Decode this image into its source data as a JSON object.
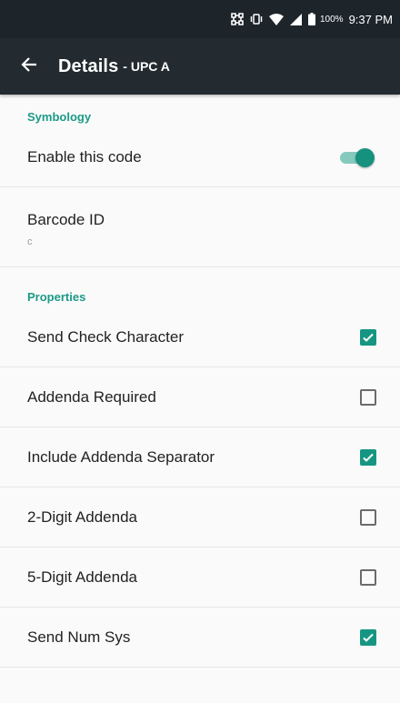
{
  "status_bar": {
    "battery_percent": "100%",
    "time": "9:37 PM",
    "icons": [
      "scanner-icon",
      "vibrate-icon",
      "wifi-icon",
      "signal-icon",
      "battery-icon"
    ]
  },
  "app_bar": {
    "title": "Details",
    "subtitle": "- UPC A",
    "back_icon": "arrow-back-icon",
    "color": "#232b30"
  },
  "colors": {
    "accent": "#1c9a86",
    "checkbox_checked": "#169682",
    "toggle_thumb": "#16917d",
    "toggle_track": "#86c9bd"
  },
  "symbology": {
    "header": "Symbology",
    "enable_label": "Enable this code",
    "enable_on": true,
    "barcode_id_label": "Barcode ID",
    "barcode_id_value": "c"
  },
  "properties": {
    "header": "Properties",
    "items": [
      {
        "label": "Send Check Character",
        "checked": true
      },
      {
        "label": "Addenda Required",
        "checked": false
      },
      {
        "label": "Include Addenda Separator",
        "checked": true
      },
      {
        "label": "2-Digit Addenda",
        "checked": false
      },
      {
        "label": "5-Digit Addenda",
        "checked": false
      },
      {
        "label": "Send Num Sys",
        "checked": true
      }
    ]
  }
}
